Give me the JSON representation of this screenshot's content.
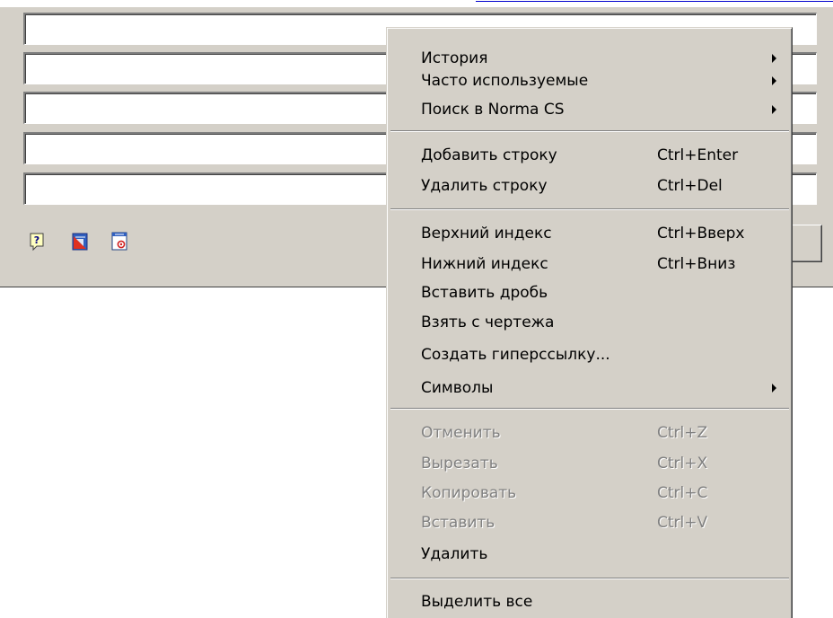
{
  "panel": {
    "fields": [
      "",
      "",
      "",
      "",
      ""
    ],
    "toolbar_icons": [
      "help-icon",
      "drawing-icon",
      "settings-window-icon"
    ]
  },
  "context_menu": {
    "items": [
      {
        "label": "История",
        "submenu": true
      },
      {
        "label": "Часто используемые",
        "submenu": true
      },
      {
        "label": "Поиск в Norma CS",
        "submenu": true
      },
      {
        "label": "Добавить строку",
        "shortcut": "Ctrl+Enter"
      },
      {
        "label": "Удалить строку",
        "shortcut": "Ctrl+Del"
      },
      {
        "label": "Верхний индекс",
        "shortcut": "Ctrl+Вверх"
      },
      {
        "label": "Нижний индекс",
        "shortcut": "Ctrl+Вниз"
      },
      {
        "label": "Вставить дробь"
      },
      {
        "label": "Взять с чертежа"
      },
      {
        "label": "Создать гиперссылку..."
      },
      {
        "label": "Символы",
        "submenu": true
      },
      {
        "label": "Отменить",
        "shortcut": "Ctrl+Z",
        "enabled": false
      },
      {
        "label": "Вырезать",
        "shortcut": "Ctrl+X",
        "enabled": false
      },
      {
        "label": "Копировать",
        "shortcut": "Ctrl+C",
        "enabled": false
      },
      {
        "label": "Вставить",
        "shortcut": "Ctrl+V",
        "enabled": false
      },
      {
        "label": "Удалить",
        "enabled": true
      },
      {
        "label": "Выделить все"
      }
    ]
  },
  "colors": {
    "face": "#d4d0c8",
    "shadow": "#808080",
    "dark_shadow": "#404040",
    "highlight": "#ffffff",
    "disabled_text": "#808080"
  }
}
